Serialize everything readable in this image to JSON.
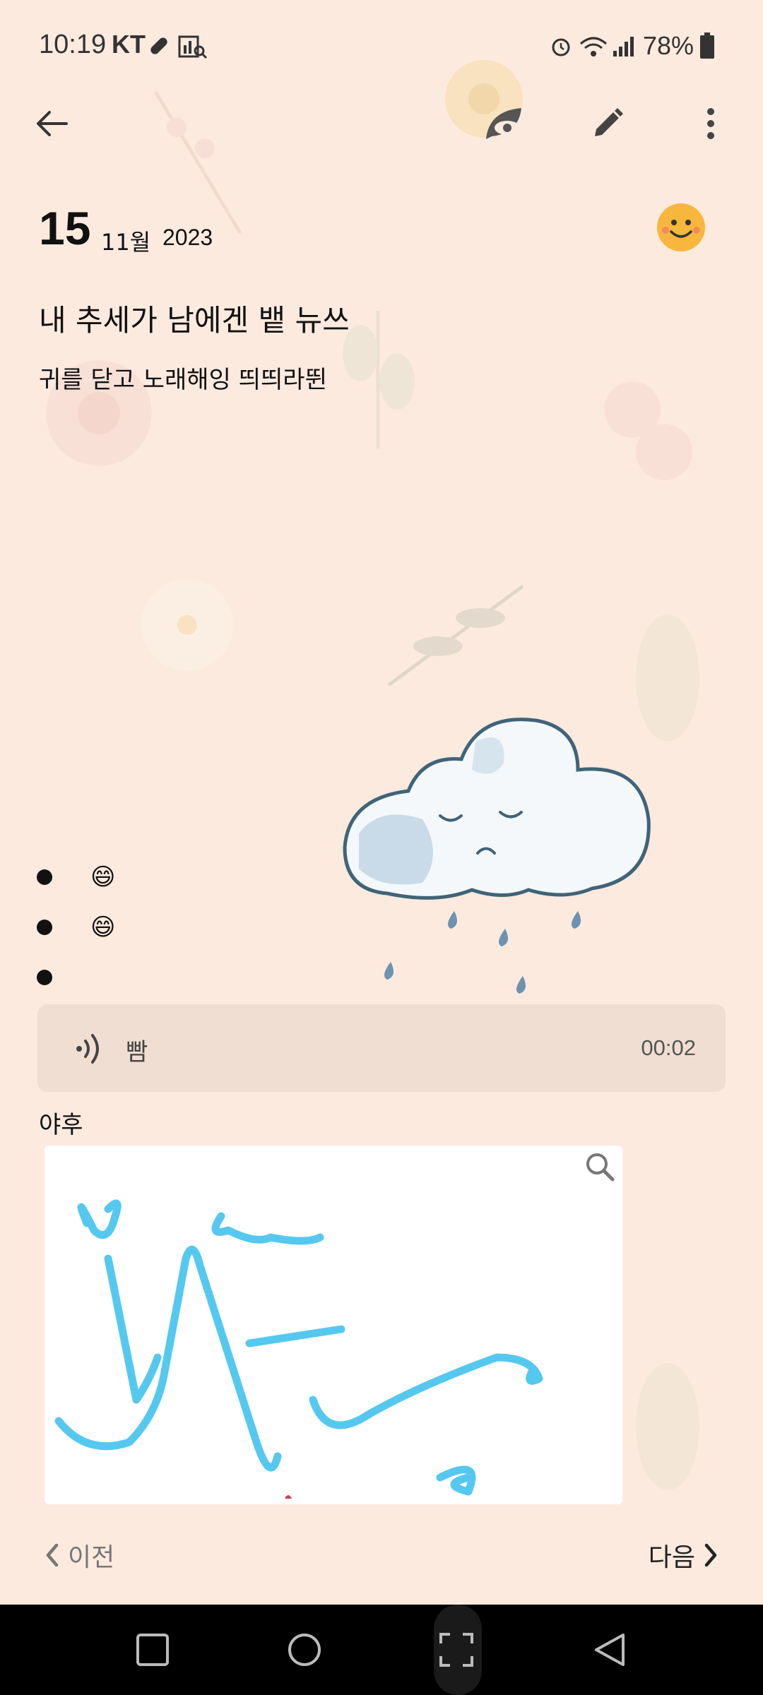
{
  "status_bar": {
    "time": "10:19",
    "carrier": "KT",
    "battery": "78%",
    "icons": [
      "pill-icon",
      "chart-search-icon",
      "alarm-icon",
      "wifi-icon",
      "signal-icon",
      "battery-icon"
    ]
  },
  "app_bar": {
    "icons": [
      "back-arrow-icon",
      "leaf-eye-icon",
      "pencil-icon",
      "more-vert-icon"
    ]
  },
  "entry": {
    "day": "15",
    "month": "11월",
    "year": "2023",
    "mood_icon": "smiley-face-icon",
    "title": "내 추세가 남에겐 뱉 뉴쓰",
    "body": "귀를 닫고 노래해잉 띄띄라뛴",
    "bullets": [
      "😄",
      "😄",
      ""
    ],
    "sticker": "rain-cloud-sticker"
  },
  "voice_note": {
    "label": "빰",
    "duration": "00:02",
    "icon": "audio-wave-icon"
  },
  "drawing": {
    "caption": "야후",
    "zoom_icon": "magnifier-icon",
    "stroke_color": "#55c8f0"
  },
  "navigation": {
    "prev_label": "이전",
    "next_label": "다음"
  },
  "colors": {
    "background": "#fdeadf",
    "mood_yellow": "#f7b73c",
    "voice_bg": "#f0ded3"
  }
}
